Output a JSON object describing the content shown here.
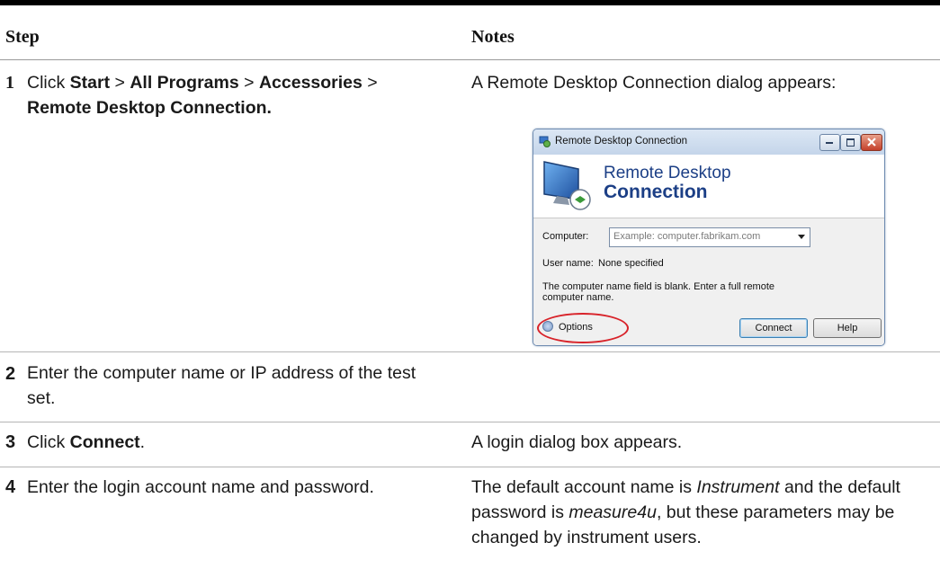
{
  "header": {
    "step": "Step",
    "notes": "Notes"
  },
  "rows": [
    {
      "num": "1",
      "step": {
        "pre": "Click ",
        "a": "Start",
        "s1": " > ",
        "b": "All Programs",
        "s2": " > ",
        "c": "Accessories",
        "s3": " >",
        "d": "Remote Desktop Connection."
      },
      "notes": "A Remote Desktop Connection dialog appears:"
    },
    {
      "num": "2",
      "step": "Enter the computer name or IP address of the test set.",
      "notes": ""
    },
    {
      "num": "3",
      "step": {
        "pre": "Click ",
        "bold": "Connect",
        "post": "."
      },
      "notes": "A login dialog box appears."
    },
    {
      "num": "4",
      "step": "Enter the login account name and password.",
      "notes": {
        "p1": "The default account name is ",
        "i1": "Instrument",
        "p2": " and the default password is ",
        "i2": "measure4u",
        "p3": ", but these parameters may be changed by instrument users."
      }
    }
  ],
  "dialog": {
    "title": "Remote Desktop Connection",
    "banner_line1": "Remote Desktop",
    "banner_line2": "Connection",
    "computer_label": "Computer:",
    "computer_placeholder": "Example: computer.fabrikam.com",
    "username_label": "User name:",
    "username_value": "None specified",
    "message": "The computer name field is blank. Enter a full remote computer name.",
    "options_label": "Options",
    "connect_label": "Connect",
    "help_label": "Help",
    "highlight_color": "#d8232a"
  }
}
